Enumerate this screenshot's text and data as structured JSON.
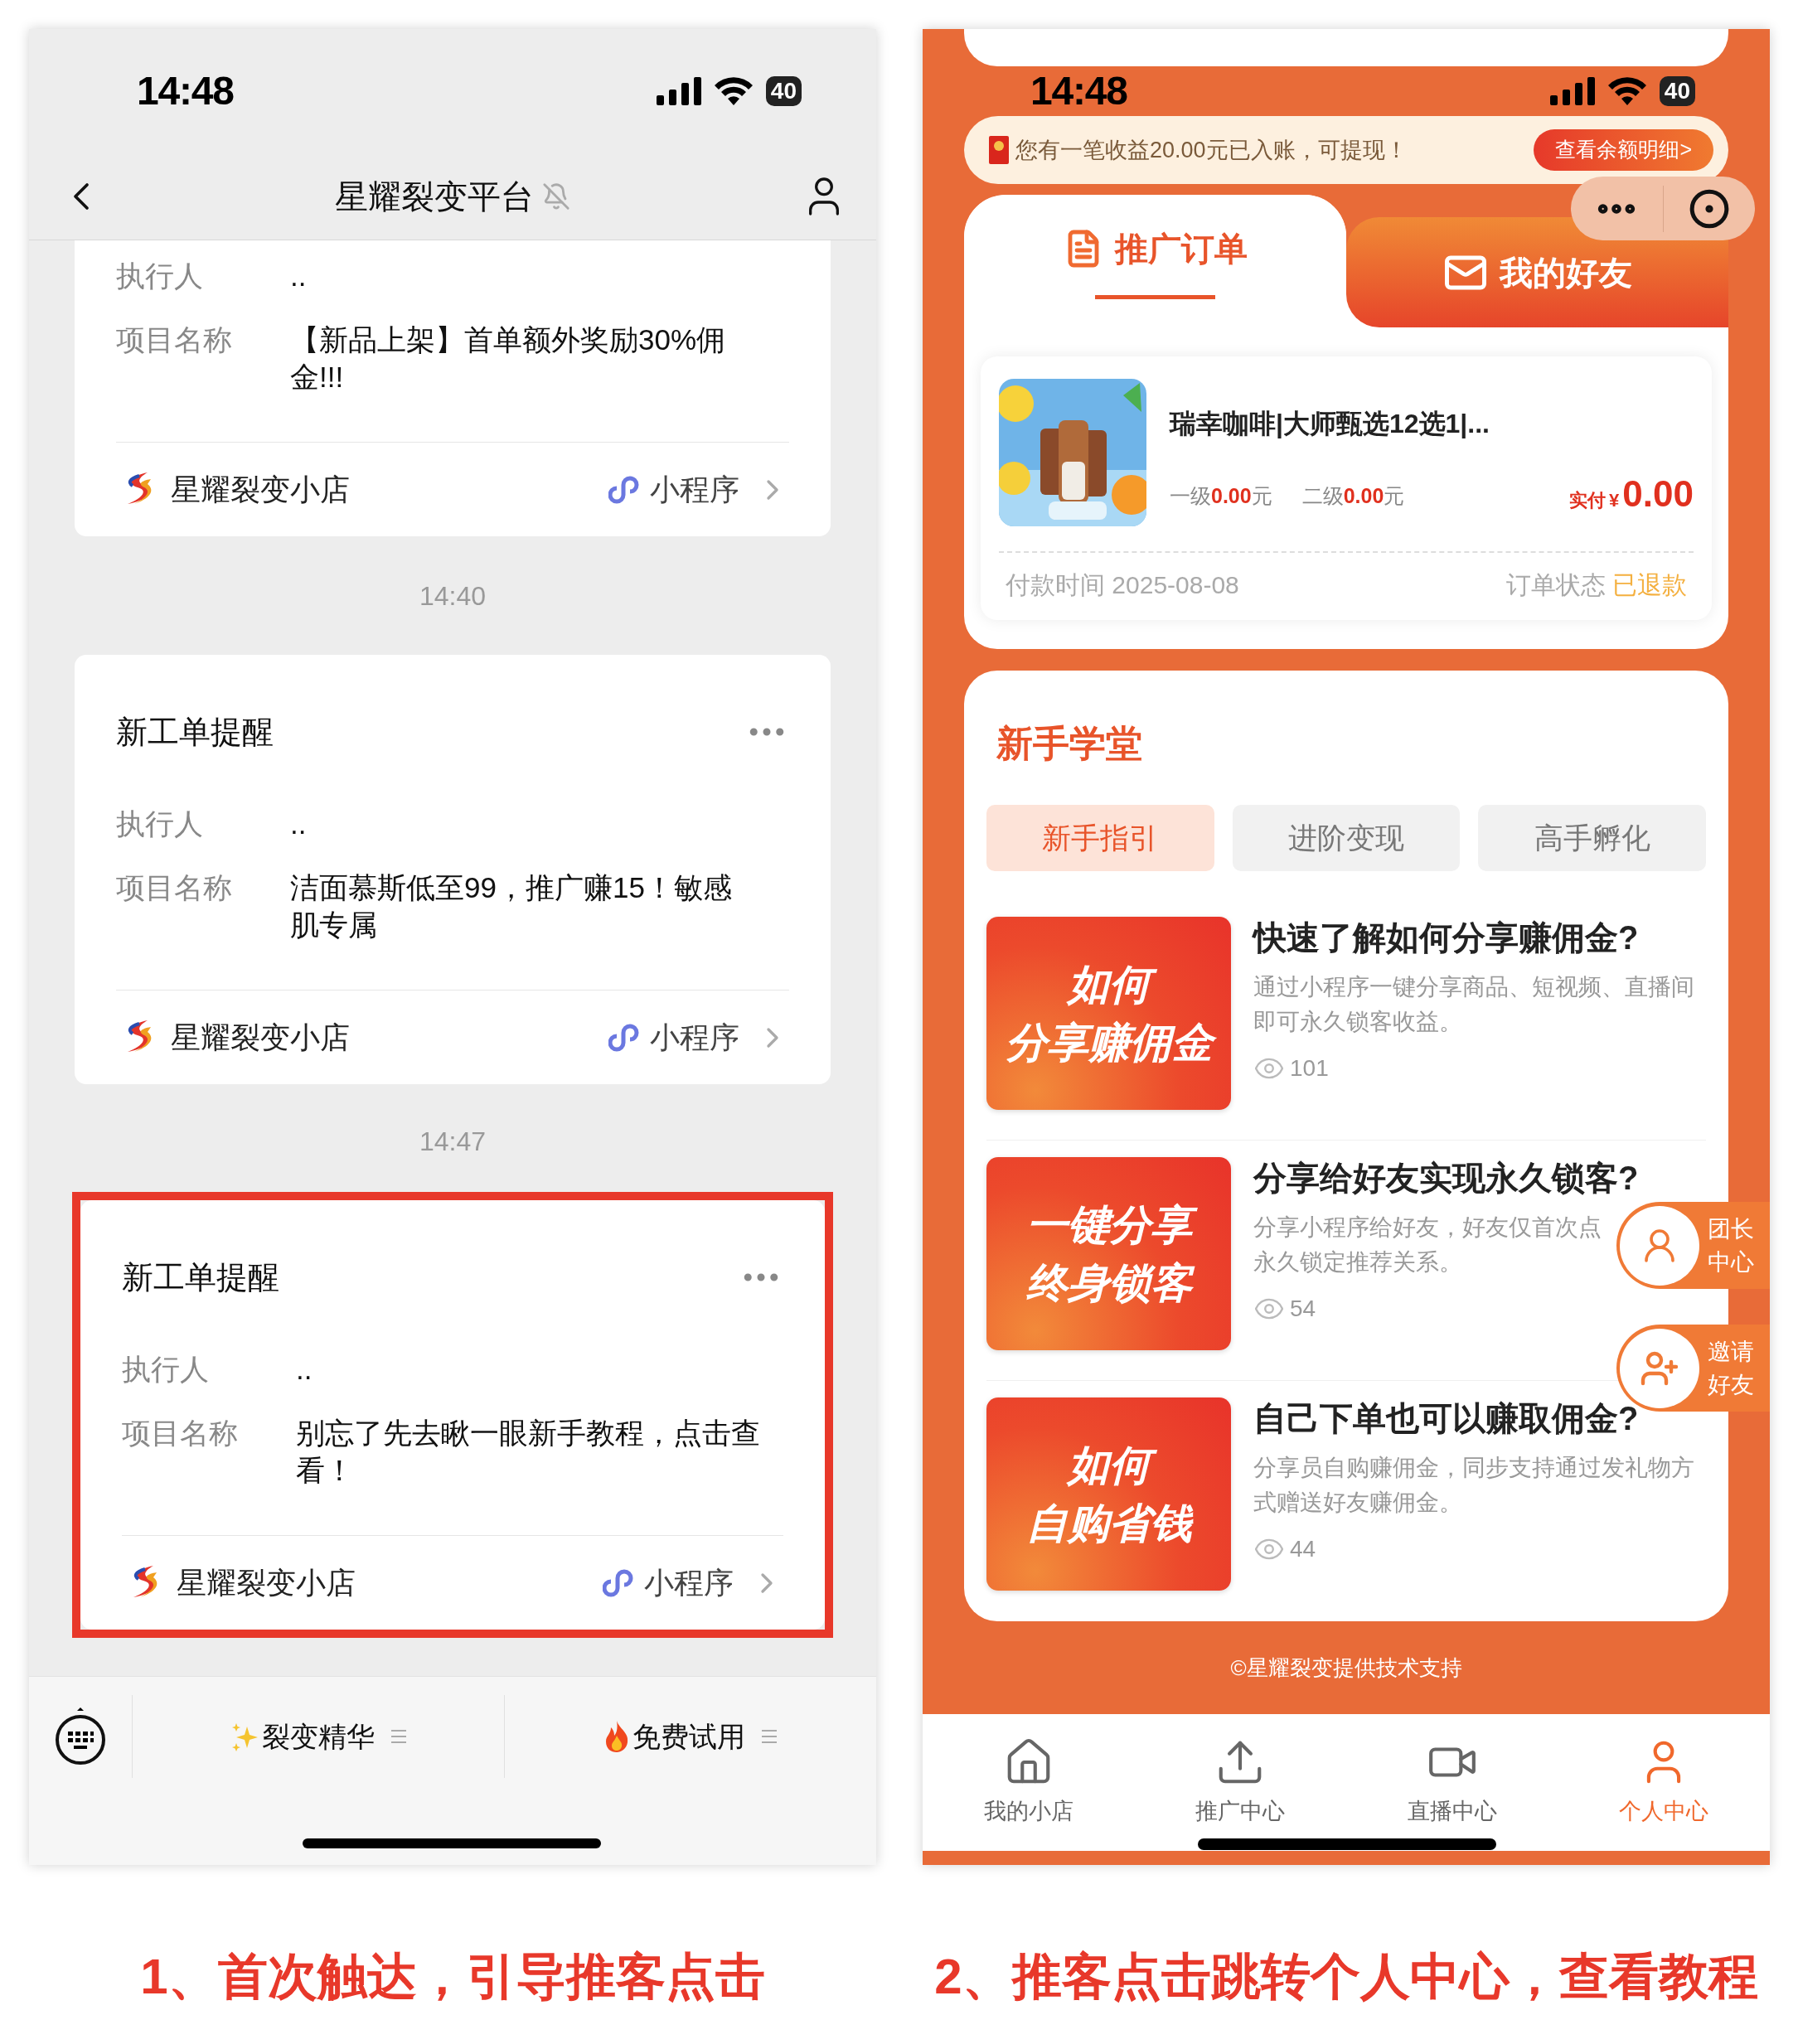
{
  "chat": {
    "status_bar": {
      "time": "14:48",
      "battery": "40"
    },
    "title": "星耀裂变平台",
    "items": [
      {
        "kind": "card",
        "cut_top": true,
        "highlighted": false,
        "fields": [
          {
            "label": "执行人",
            "value": ".."
          },
          {
            "label": "项目名称",
            "value": "【新品上架】首单额外奖励30%佣金!!!"
          }
        ],
        "source": "星耀裂变小店",
        "app_label": "小程序"
      },
      {
        "kind": "time",
        "text": "14:40"
      },
      {
        "kind": "card",
        "cut_top": false,
        "highlighted": false,
        "title": "新工单提醒",
        "fields": [
          {
            "label": "执行人",
            "value": ".."
          },
          {
            "label": "项目名称",
            "value": "洁面慕斯低至99，推广赚15！敏感肌专属"
          }
        ],
        "source": "星耀裂变小店",
        "app_label": "小程序"
      },
      {
        "kind": "time",
        "text": "14:47"
      },
      {
        "kind": "card",
        "cut_top": false,
        "highlighted": true,
        "title": "新工单提醒",
        "fields": [
          {
            "label": "执行人",
            "value": ".."
          },
          {
            "label": "项目名称",
            "value": "别忘了先去瞅一眼新手教程，点击查看！"
          }
        ],
        "source": "星耀裂变小店",
        "app_label": "小程序"
      }
    ],
    "menu": [
      {
        "label": "裂变精华"
      },
      {
        "label": "免费试用"
      }
    ]
  },
  "shop": {
    "status_bar": {
      "time": "14:48",
      "battery": "40"
    },
    "notice": {
      "text": "您有一笔收益20.00元已入账，可提现！",
      "button": "查看余额明细>"
    },
    "tabs": [
      {
        "label": "推广订单",
        "selected": true
      },
      {
        "label": "我的好友",
        "selected": false
      }
    ],
    "order": {
      "title": "瑞幸咖啡|大师甄选12选1|...",
      "commissions": [
        {
          "label": "一级",
          "amount": "0.00",
          "unit": "元"
        },
        {
          "label": "二级",
          "amount": "0.00",
          "unit": "元"
        }
      ],
      "paid_label": "实付",
      "currency": "¥",
      "paid_amount": "0.00",
      "time_label": "付款时间",
      "time": "2025-08-08",
      "status_label": "订单状态",
      "status": "已退款"
    },
    "school": {
      "title": "新手学堂",
      "tabs": [
        {
          "label": "新手指引",
          "selected": true
        },
        {
          "label": "进阶变现",
          "selected": false
        },
        {
          "label": "高手孵化",
          "selected": false
        }
      ],
      "articles": [
        {
          "cover": [
            "如何",
            "分享赚佣金"
          ],
          "title": "快速了解如何分享赚佣金?",
          "desc": [
            "通过小程序一键分享商品、短视频、直播间",
            "即可永久锁客收益。"
          ],
          "views": "101"
        },
        {
          "cover": [
            "一键分享",
            "终身锁客"
          ],
          "title": "分享给好友实现永久锁客?",
          "desc": [
            "分享小程序给好友，好友仅首次点",
            "永久锁定推荐关系。"
          ],
          "views": "54"
        },
        {
          "cover": [
            "如何",
            "自购省钱"
          ],
          "title": "自己下单也可以赚取佣金?",
          "desc": [
            "分享员自购赚佣金，同步支持通过发礼物方",
            "式赠送好友赚佣金。"
          ],
          "views": "44"
        }
      ]
    },
    "floating_buttons": [
      {
        "kind": "leader",
        "lines": [
          "团长",
          "中心"
        ]
      },
      {
        "kind": "invite",
        "lines": [
          "邀请",
          "好友"
        ]
      }
    ],
    "footer": "©星耀裂变提供技术支持",
    "nav": [
      {
        "label": "我的小店",
        "selected": false
      },
      {
        "label": "推广中心",
        "selected": false
      },
      {
        "label": "直播中心",
        "selected": false
      },
      {
        "label": "个人中心",
        "selected": true
      }
    ]
  },
  "captions": [
    "1、首次触达，引导推客点击",
    "2、推客点击跳转个人中心，查看教程"
  ]
}
